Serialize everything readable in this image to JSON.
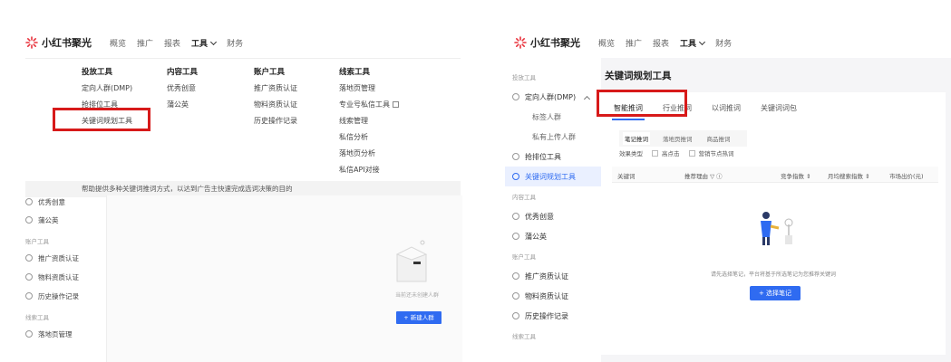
{
  "brand": {
    "name": "小红书聚光"
  },
  "nav": {
    "overview": "概览",
    "promote": "推广",
    "report": "报表",
    "tools": "工具",
    "finance": "财务"
  },
  "megamenu": {
    "col1": {
      "title": "投放工具",
      "items": [
        "定向人群(DMP)",
        "抢排位工具",
        "关键词规划工具"
      ]
    },
    "col2": {
      "title": "内容工具",
      "items": [
        "优秀创意",
        "蒲公英"
      ]
    },
    "col3": {
      "title": "账户工具",
      "items": [
        "推广资质认证",
        "物料资质认证",
        "历史操作记录"
      ]
    },
    "col4": {
      "title": "线索工具",
      "items": [
        "落地页管理",
        "专业号私信工具",
        "线索管理",
        "私信分析",
        "落地页分析",
        "私信API对接"
      ]
    },
    "footer": "帮助提供多种关键词推词方式，以达到广告主快速完成选词决策的目的"
  },
  "left_sidebar": {
    "items": [
      "优秀创意",
      "蒲公英"
    ],
    "section_account": "账户工具",
    "account_items": [
      "推广资质认证",
      "物料资质认证",
      "历史操作记录"
    ],
    "section_leads": "线索工具",
    "lead_items": [
      "落地页管理"
    ]
  },
  "left_empty": {
    "text": "当前还未创建人群",
    "button": "+ 新建人群"
  },
  "right_sidebar": {
    "section_ad": "投放工具",
    "dmp": "定向人群(DMP)",
    "dmp_sub": [
      "标签人群",
      "私有上传人群"
    ],
    "rank": "抢排位工具",
    "keyword": "关键词规划工具",
    "section_content": "内容工具",
    "content_items": [
      "优秀创意",
      "蒲公英"
    ],
    "section_account": "账户工具",
    "account_items": [
      "推广资质认证",
      "物料资质认证",
      "历史操作记录"
    ],
    "section_leads": "线索工具"
  },
  "right_main": {
    "title": "关键词规划工具",
    "tabs": [
      "智能推词",
      "行业推词",
      "以词推词",
      "关键词词包"
    ],
    "subtabs": [
      "笔记推词",
      "落地页推词",
      "商品推词"
    ],
    "filter_label": "效果类型",
    "filters": [
      "高点击",
      "营销节点热词"
    ],
    "columns": [
      "关键词",
      "推荐理由 ▽ ⓘ",
      "竞争指数 ⇕",
      "月均搜索指数 ⇕",
      "市场出价(元)"
    ],
    "empty_text": "请先选择笔记，平台将基于所选笔记为您推荐关键词",
    "button": "+ 选择笔记"
  }
}
